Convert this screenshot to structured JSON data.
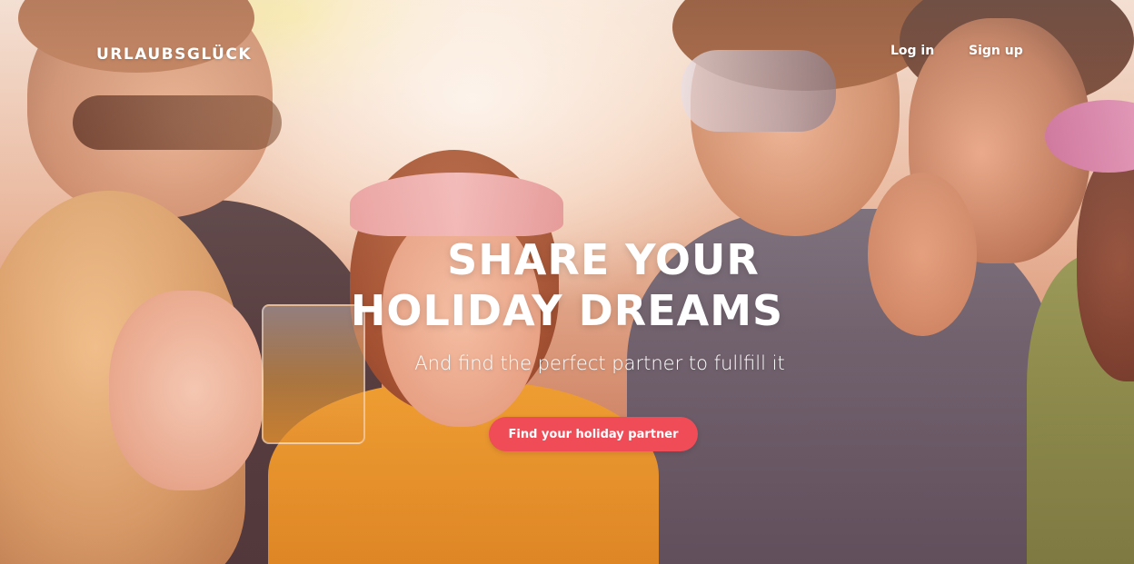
{
  "nav": {
    "brand": "URLAUBSGLÜCK",
    "login_label": "Log in",
    "signup_label": "Sign up"
  },
  "hero": {
    "headline_line1": "SHARE YOUR",
    "headline_line2": "HOLIDAY DREAMS",
    "subheadline": "And find the perfect partner to fullfill it",
    "cta_label": "Find your holiday partner",
    "background_image": "group of friends laughing with sunglasses and drinks"
  },
  "colors": {
    "cta_background": "#ef4c57",
    "text": "#ffffff"
  }
}
